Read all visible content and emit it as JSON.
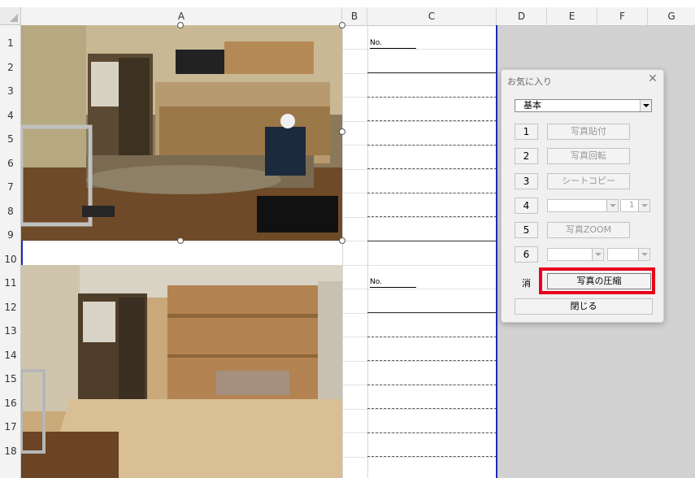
{
  "columns": [
    "A",
    "B",
    "C",
    "D",
    "E",
    "F",
    "G"
  ],
  "rows": [
    "1",
    "2",
    "3",
    "4",
    "5",
    "6",
    "7",
    "8",
    "9",
    "10",
    "11",
    "12",
    "13",
    "14",
    "15",
    "16",
    "17",
    "18"
  ],
  "sheet": {
    "no_label_1": "No.",
    "no_label_2": "No."
  },
  "dialog": {
    "title": "お気に入り",
    "close_glyph": "✕",
    "main_combo_value": "基本",
    "rows": [
      {
        "num": "1",
        "action": "写真貼付"
      },
      {
        "num": "2",
        "action": "写真回転"
      },
      {
        "num": "3",
        "action": "シートコピー"
      },
      {
        "num": "4",
        "combo_small_value": "1"
      },
      {
        "num": "5",
        "action": "写真ZOOM"
      },
      {
        "num": "6"
      }
    ],
    "erase_label": "消",
    "compress_label": "写真の圧縮",
    "close_label": "閉じる"
  },
  "colors": {
    "highlight": "#e8001c",
    "print_area_line": "#1c2bb8",
    "outside_area": "#d2d2d2"
  },
  "photos": [
    {
      "name": "kitchen-before-renovation"
    },
    {
      "name": "kitchen-after-renovation"
    }
  ]
}
